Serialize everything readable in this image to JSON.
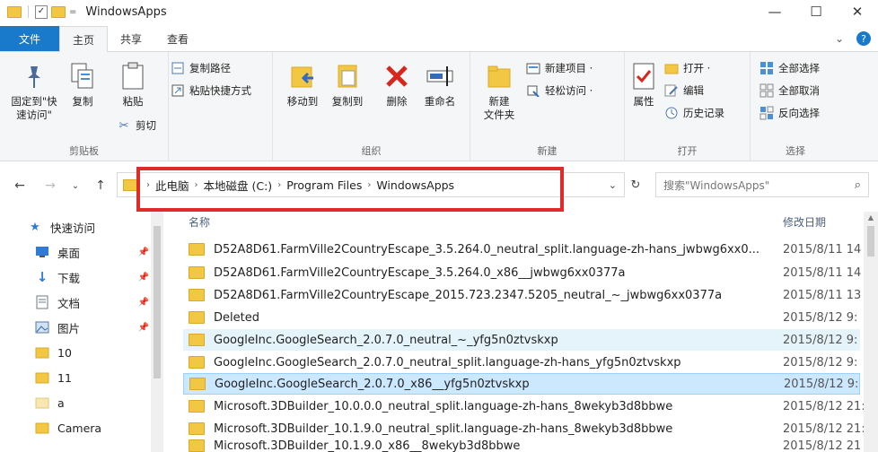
{
  "window": {
    "title": "WindowsApps",
    "minimize": "—",
    "maximize": "☐",
    "close": "✕"
  },
  "quick_access_toolbar": {
    "dropdown": "="
  },
  "tabs": {
    "file": "文件",
    "home": "主页",
    "share": "共享",
    "view": "查看",
    "expand": "⌄",
    "help": "?"
  },
  "ribbon": {
    "clipboard": {
      "label": "剪贴板",
      "pin": "固定到\"快\n速访问\"",
      "copy": "复制",
      "paste": "粘贴",
      "copy_path": "复制路径",
      "paste_shortcut": "粘贴快捷方式",
      "cut": "剪切"
    },
    "organize": {
      "label": "组织",
      "move_to": "移动到",
      "copy_to": "复制到",
      "delete": "删除",
      "rename": "重命名"
    },
    "new": {
      "label": "新建",
      "new_folder": "新建\n文件夹",
      "new_item": "新建项目 ·",
      "easy_access": "轻松访问 ·"
    },
    "open": {
      "label": "打开",
      "properties": "属性",
      "open": "打开 ·",
      "edit": "编辑",
      "history": "历史记录"
    },
    "select": {
      "label": "选择",
      "select_all": "全部选择",
      "select_none": "全部取消",
      "invert": "反向选择"
    }
  },
  "navigation": {
    "back": "←",
    "forward": "→",
    "recent": "⌄",
    "up": "↑",
    "refresh": "↻",
    "address_dropdown": "⌄"
  },
  "breadcrumbs": [
    "此电脑",
    "本地磁盘 (C:)",
    "Program Files",
    "WindowsApps"
  ],
  "breadcrumb_separator": "›",
  "search": {
    "placeholder": "搜索\"WindowsApps\"",
    "icon": "⌕"
  },
  "nav_pane": {
    "pin_glyph": "📌",
    "items": [
      {
        "label": "快速访问",
        "icon": "star-icon"
      },
      {
        "label": "桌面",
        "icon": "desktop-icon",
        "pinned": true
      },
      {
        "label": "下载",
        "icon": "download-icon",
        "pinned": true
      },
      {
        "label": "文档",
        "icon": "document-icon",
        "pinned": true
      },
      {
        "label": "图片",
        "icon": "pictures-icon",
        "pinned": true
      },
      {
        "label": "10",
        "icon": "folder-icon"
      },
      {
        "label": "11",
        "icon": "folder-icon"
      },
      {
        "label": "a",
        "icon": "folder-icon"
      },
      {
        "label": "Camera",
        "icon": "folder-icon"
      }
    ]
  },
  "file_list": {
    "col_name": "名称",
    "col_date": "修改日期",
    "rows": [
      {
        "name": "D52A8D61.FarmVille2CountryEscape_3.5.264.0_neutral_split.language-zh-hans_jwbwg6xx0...",
        "date": "2015/8/11 14"
      },
      {
        "name": "D52A8D61.FarmVille2CountryEscape_3.5.264.0_x86__jwbwg6xx0377a",
        "date": "2015/8/11 14"
      },
      {
        "name": "D52A8D61.FarmVille2CountryEscape_2015.723.2347.5205_neutral_~_jwbwg6xx0377a",
        "date": "2015/8/11 13"
      },
      {
        "name": "Deleted",
        "date": "2015/8/12 9:"
      },
      {
        "name": "GoogleInc.GoogleSearch_2.0.7.0_neutral_~_yfg5n0ztvskxp",
        "date": "2015/8/12 9:"
      },
      {
        "name": "GoogleInc.GoogleSearch_2.0.7.0_neutral_split.language-zh-hans_yfg5n0ztvskxp",
        "date": "2015/8/12 9:"
      },
      {
        "name": "GoogleInc.GoogleSearch_2.0.7.0_x86__yfg5n0ztvskxp",
        "date": "2015/8/12 9:"
      },
      {
        "name": "Microsoft.3DBuilder_10.0.0.0_neutral_split.language-zh-hans_8wekyb3d8bbwe",
        "date": "2015/8/12 21:"
      },
      {
        "name": "Microsoft.3DBuilder_10.1.9.0_neutral_split.language-zh-hans_8wekyb3d8bbwe",
        "date": "2015/8/12 21:"
      },
      {
        "name": "Microsoft.3DBuilder_10.1.9.0_x86__8wekyb3d8bbwe",
        "date": "2015/8/12 21:"
      }
    ]
  }
}
